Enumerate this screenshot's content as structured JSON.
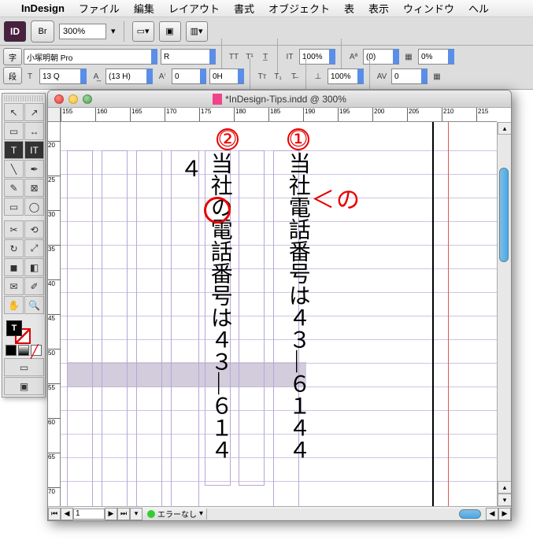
{
  "menubar": {
    "app": "InDesign",
    "items": [
      "ファイル",
      "編集",
      "レイアウト",
      "書式",
      "オブジェクト",
      "表",
      "表示",
      "ウィンドウ",
      "ヘル"
    ]
  },
  "control": {
    "br": "Br",
    "zoom": "300%"
  },
  "charpanel": {
    "left1": "字",
    "left2": "段",
    "font": "小塚明朝 Pro",
    "style": "R",
    "size": "13 Q",
    "leading": "(13 H)",
    "tracking": "0",
    "kerning": "0H",
    "scale1": "100%",
    "scale2": "100%",
    "baseline": "(0)",
    "skew": "0",
    "pct": "0%"
  },
  "doc": {
    "title": "*InDesign-Tips.indd @ 300%",
    "ruler_h": [
      "155",
      "160",
      "165",
      "170",
      "175",
      "180",
      "185",
      "190",
      "195",
      "200",
      "205",
      "210",
      "215"
    ],
    "ruler_v": [
      "20",
      "25",
      "30",
      "35",
      "40",
      "45",
      "50",
      "55",
      "60",
      "65",
      "70"
    ],
    "text1": "当社電話番号は４３―６１４４",
    "text2": "当社の電話番号は４３―６１４",
    "text3": "４",
    "anno1": "①",
    "anno2": "②",
    "anno_no": "の",
    "page": "1",
    "errors": "エラーなし"
  }
}
